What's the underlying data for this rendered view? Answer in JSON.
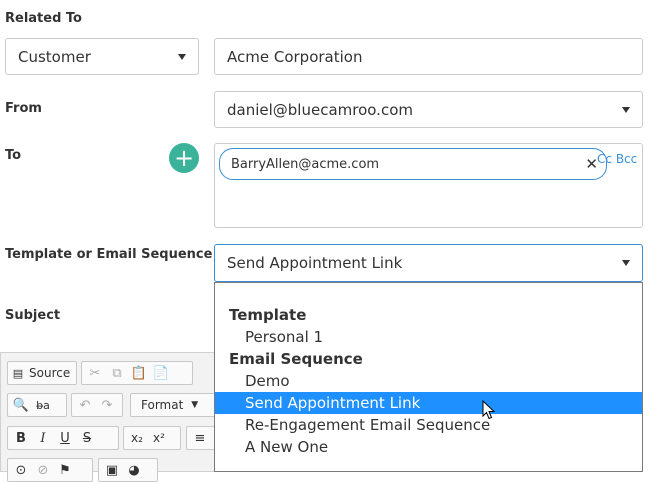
{
  "related_to": {
    "label": "Related To",
    "type_value": "Customer",
    "name_value": "Acme Corporation"
  },
  "from": {
    "label": "From",
    "value": "daniel@bluecamroo.com"
  },
  "to": {
    "label": "To",
    "add_icon": "plus-icon",
    "recipient": "BarryAllen@acme.com",
    "cc": "Cc",
    "bcc": "Bcc"
  },
  "template": {
    "label": "Template or Email Sequence",
    "value": "Send Appointment Link",
    "dropdown": {
      "group1": "Template",
      "group1_items": [
        "Personal 1"
      ],
      "group2": "Email Sequence",
      "group2_items": [
        "Demo",
        "Send Appointment Link",
        "Re-Engagement Email Sequence",
        "A New One"
      ]
    }
  },
  "subject": {
    "label": "Subject"
  },
  "editor": {
    "source_label": "Source",
    "format_label": "Format"
  },
  "colors": {
    "accent": "#3a8fd6",
    "add_button": "#3bb39b",
    "selected": "#1e90ff"
  }
}
